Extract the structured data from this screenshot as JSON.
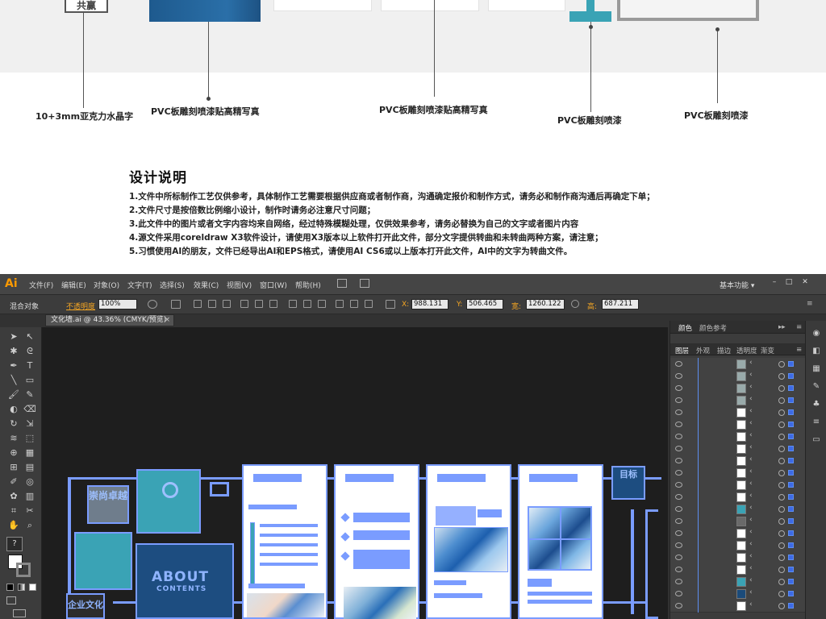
{
  "mockup": {
    "logo_text": "共赢",
    "callouts": [
      "10+3mm亚克力水晶字",
      "PVC板雕刻喷漆贴高精写真",
      "PVC板雕刻喷漆贴高精写真",
      "PVC板雕刻喷漆",
      "PVC板雕刻喷漆"
    ]
  },
  "notes": {
    "title": "设计说明",
    "lines": [
      "1.文件中所标制作工艺仅供参考，具体制作工艺需要根据供应商或者制作商，沟通确定报价和制作方式，请务必和制作商沟通后再确定下单；",
      "2.文件尺寸是按倍数比例缩小设计，制作时请务必注意尺寸问题；",
      "3.此文件中的图片或者文字内容均来自网络，经过特殊模糊处理，仅供效果参考，请务必替换为自己的文字或者图片内容",
      "4.源文件采用coreldraw X3软件设计，请使用X3版本以上软件打开此文件，部分文字提供转曲和未转曲两种方案，请注意；",
      "5.习惯使用AI的朋友，文件已经导出AI和EPS格式，请使用AI CS6或以上版本打开此文件，AI中的文字为转曲文件。"
    ]
  },
  "ai": {
    "logo": "Ai",
    "menus": [
      "文件(F)",
      "编辑(E)",
      "对象(O)",
      "文字(T)",
      "选择(S)",
      "效果(C)",
      "视图(V)",
      "窗口(W)",
      "帮助(H)"
    ],
    "workspace": "基本功能",
    "window_controls": [
      "–",
      "□",
      "✕"
    ],
    "control_bar": {
      "object_type": "混合对象",
      "opacity_label": "不透明度",
      "opacity_value": "100%",
      "x_label": "X:",
      "x_value": "988.131",
      "y_label": "Y:",
      "y_value": "506.465",
      "w_label": "宽:",
      "w_value": "1260.122",
      "h_label": "高:",
      "h_value": "687.211"
    },
    "document_tab": "文化墙.ai @ 43.36% (CMYK/预览)",
    "document_tab_close": "×",
    "panel": {
      "top_tabs": [
        "颜色",
        "颜色参考"
      ],
      "tabs": [
        "图层",
        "外观",
        "描边",
        "透明度",
        "渐变"
      ],
      "layer_thumb_colors": [
        "#9aa",
        "#9aa",
        "#9aa",
        "#9aa",
        "#ffffff",
        "#ffffff",
        "#ffffff",
        "#ffffff",
        "#ffffff",
        "#ffffff",
        "#ffffff",
        "#ffffff",
        "#3aa3b5",
        "#6a6a6a",
        "#ffffff",
        "#ffffff",
        "#ffffff",
        "#ffffff",
        "#3aa3b5",
        "#1b4b7a",
        "#ffffff"
      ]
    },
    "artboard": {
      "sign_left": "崇尚卓越",
      "about_title": "ABOUT",
      "about_sub": "CONTENTS",
      "right_sign": "目标",
      "bottom_label": "企业文化"
    }
  }
}
